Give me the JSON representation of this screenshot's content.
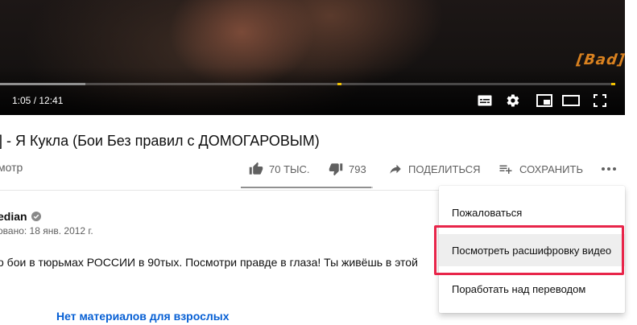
{
  "player": {
    "watermark": "[Bad]",
    "time_display": "1:05 / 12:41",
    "progress_played_fraction": 0.139,
    "chapter_markers_fraction": [
      0.549,
      0.993
    ],
    "controls": [
      "subtitles-icon",
      "settings-icon",
      "miniplayer-icon",
      "theater-mode-icon",
      "fullscreen-icon"
    ]
  },
  "video": {
    "title": "] - Я Кукла (Бои Без правил с ДОМОГАРОВЫМ)",
    "views_fragment": "мотр",
    "like_count": "70 ТЫС.",
    "dislike_count": "793",
    "share_label": "ПОДЕЛИТЬСЯ",
    "save_label": "СОХРАНИТЬ",
    "like_ratio": 0.989
  },
  "channel": {
    "name_fragment": "edian",
    "published": "овано: 18 янв. 2012 г.",
    "description": "о бои в тюрьмах РОССИИ в 90тых. Посмотри правде в глаза! Ты живёшь в этой",
    "age_notice": "Нет материалов для взрослых"
  },
  "menu": {
    "items": [
      {
        "label": "Пожаловаться"
      },
      {
        "label": "Посмотреть расшифровку видео"
      },
      {
        "label": "Поработать над переводом"
      }
    ],
    "highlighted_index": 1
  },
  "colors": {
    "highlight_border": "#e8254a",
    "link": "#065fd4",
    "chapter_marker": "#f2c200"
  }
}
